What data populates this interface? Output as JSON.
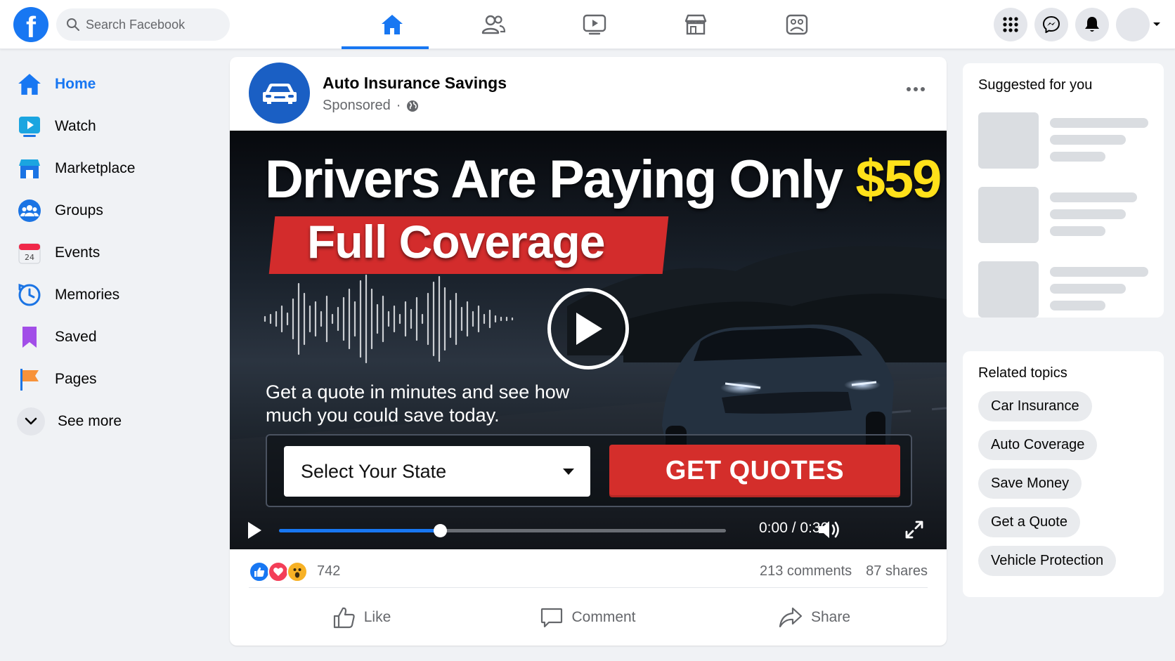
{
  "topbar": {
    "logo": "f",
    "search_placeholder": "Search Facebook",
    "nav_tabs": [
      {
        "icon": "home-icon",
        "active": true
      },
      {
        "icon": "friends-icon",
        "active": false
      },
      {
        "icon": "watch-icon",
        "active": false
      },
      {
        "icon": "marketplace-icon",
        "active": false
      },
      {
        "icon": "gaming-icon",
        "active": false
      }
    ],
    "right_icons": [
      "menu-grid-icon",
      "messenger-icon",
      "notifications-icon",
      "account-avatar"
    ]
  },
  "sidebar": {
    "items": [
      {
        "label": "Home",
        "icon": "home-icon",
        "active": true
      },
      {
        "label": "Watch",
        "icon": "watch-icon"
      },
      {
        "label": "Marketplace",
        "icon": "marketplace-icon"
      },
      {
        "label": "Groups",
        "icon": "groups-icon"
      },
      {
        "label": "Events",
        "icon": "events-icon"
      },
      {
        "label": "Memories",
        "icon": "memories-icon"
      },
      {
        "label": "Saved",
        "icon": "saved-icon"
      },
      {
        "label": "Pages",
        "icon": "pages-icon"
      }
    ],
    "see_more": "See more"
  },
  "post": {
    "page_name": "Auto Insurance Savings",
    "sponsored": "Sponsored",
    "separator": "·",
    "ad": {
      "headline": "Drivers Are Paying Only",
      "price": "$59",
      "banner": "Full Coverage",
      "subtext": "Get a quote in minutes and see how much you could save today.",
      "select_label": "Select Your State",
      "cta": "GET QUOTES"
    },
    "video": {
      "time": "0:00 / 0:30",
      "progress": 0.36
    },
    "reactions_count": "742",
    "comments": "213 comments",
    "shares": "87 shares",
    "actions": {
      "like": "Like",
      "comment": "Comment",
      "share": "Share"
    }
  },
  "right": {
    "suggested_title": "Suggested for you",
    "related_title": "Related topics",
    "topics": [
      "Car Insurance",
      "Auto Coverage",
      "Save Money",
      "Get a Quote",
      "Vehicle Protection"
    ]
  },
  "colors": {
    "brand": "#1877f2",
    "cta_red": "#d42e2b",
    "price_yellow": "#ffe11a"
  }
}
